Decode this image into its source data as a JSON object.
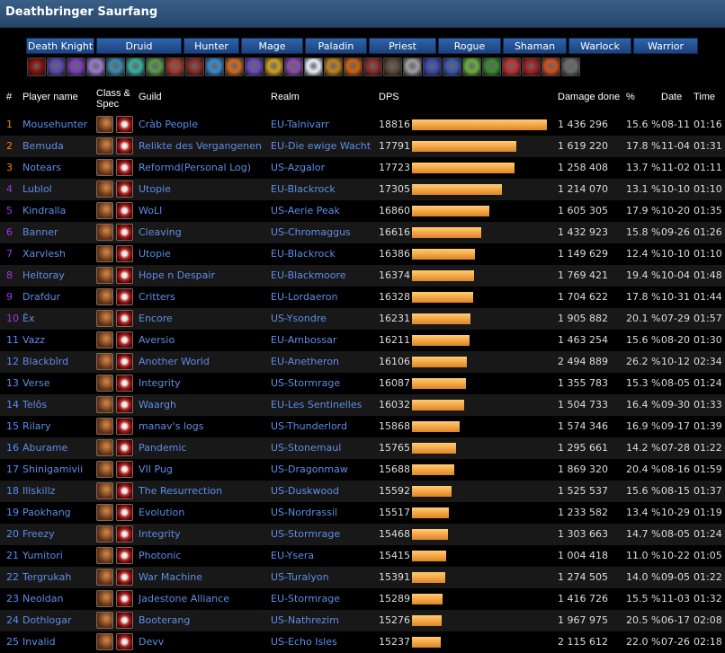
{
  "page_title": "Deathbringer Saurfang",
  "classes": [
    "Death Knight",
    "Druid",
    "Hunter",
    "Mage",
    "Paladin",
    "Priest",
    "Rogue",
    "Shaman",
    "Warlock",
    "Warrior"
  ],
  "spec_icon_colors": [
    "#8a1010",
    "#5a4ab0",
    "#7a3fb8",
    "#9a7ad0",
    "#3a8ab0",
    "#3ab0a0",
    "#5a9a4a",
    "#a43a2a",
    "#8a2a2a",
    "#3a8ad0",
    "#d06a20",
    "#6a4ac0",
    "#d0a020",
    "#8a4ab0",
    "#e8f0f8",
    "#c08020",
    "#d06010",
    "#8a2a2a",
    "#5a4a3a",
    "#a0a0a0",
    "#3a4ab0",
    "#3a5ab0",
    "#6ab040",
    "#3a8a30",
    "#c03030",
    "#a02020",
    "#d05020",
    "#6a6a6a"
  ],
  "headers": {
    "rank": "#",
    "player": "Player name",
    "class_spec_1": "Class &",
    "class_spec_2": "Spec",
    "guild": "Guild",
    "realm": "Realm",
    "dps": "DPS",
    "damage": "Damage done",
    "pct": "%",
    "date": "Date",
    "time": "Time"
  },
  "rows": [
    {
      "rank": "1",
      "player": "Mousehunter",
      "guild": "Cràb People",
      "realm": "EU-Talnivarr",
      "dps": 18816,
      "dps_label": "18816",
      "damage": "1 436 296",
      "pct": "15.6 %",
      "date": "08-11",
      "time": "01:16"
    },
    {
      "rank": "2",
      "player": "Bemuda",
      "guild": "Relikte des Vergangenen",
      "realm": "EU-Die ewige Wacht",
      "dps": 17791,
      "dps_label": "17791",
      "damage": "1 619 220",
      "pct": "17.8 %",
      "date": "11-04",
      "time": "01:31"
    },
    {
      "rank": "3",
      "player": "Notears",
      "guild": "Reformd(Personal Log)",
      "realm": "US-Azgalor",
      "dps": 17723,
      "dps_label": "17723",
      "damage": "1 258 408",
      "pct": "13.7 %",
      "date": "11-02",
      "time": "01:11"
    },
    {
      "rank": "4",
      "player": "Lublol",
      "guild": "Utopie",
      "realm": "EU-Blackrock",
      "dps": 17305,
      "dps_label": "17305",
      "damage": "1 214 070",
      "pct": "13.1 %",
      "date": "10-10",
      "time": "01:10"
    },
    {
      "rank": "5",
      "player": "Kindralla",
      "guild": "WoLl",
      "realm": "US-Aerie Peak",
      "dps": 16860,
      "dps_label": "16860",
      "damage": "1 605 305",
      "pct": "17.9 %",
      "date": "10-20",
      "time": "01:35"
    },
    {
      "rank": "6",
      "player": "Banner",
      "guild": "Cleaving",
      "realm": "US-Chromaggus",
      "dps": 16616,
      "dps_label": "16616",
      "damage": "1 432 923",
      "pct": "15.8 %",
      "date": "09-26",
      "time": "01:26"
    },
    {
      "rank": "7",
      "player": "Xarvlesh",
      "guild": "Utopie",
      "realm": "EU-Blackrock",
      "dps": 16386,
      "dps_label": "16386",
      "damage": "1 149 629",
      "pct": "12.4 %",
      "date": "10-10",
      "time": "01:10"
    },
    {
      "rank": "8",
      "player": "Heltoray",
      "guild": "Hope n Despair",
      "realm": "EU-Blackmoore",
      "dps": 16374,
      "dps_label": "16374",
      "damage": "1 769 421",
      "pct": "19.4 %",
      "date": "10-04",
      "time": "01:48"
    },
    {
      "rank": "9",
      "player": "Drafdur",
      "guild": "Critters",
      "realm": "EU-Lordaeron",
      "dps": 16328,
      "dps_label": "16328",
      "damage": "1 704 622",
      "pct": "17.8 %",
      "date": "10-31",
      "time": "01:44"
    },
    {
      "rank": "10",
      "player": "Èx",
      "guild": "Encore",
      "realm": "US-Ysondre",
      "dps": 16231,
      "dps_label": "16231",
      "damage": "1 905 882",
      "pct": "20.1 %",
      "date": "07-29",
      "time": "01:57"
    },
    {
      "rank": "11",
      "player": "Vazz",
      "guild": "Aversio",
      "realm": "EU-Ambossar",
      "dps": 16211,
      "dps_label": "16211",
      "damage": "1 463 254",
      "pct": "15.6 %",
      "date": "08-20",
      "time": "01:30"
    },
    {
      "rank": "12",
      "player": "Blackbîrd",
      "guild": "Another World",
      "realm": "EU-Anetheron",
      "dps": 16106,
      "dps_label": "16106",
      "damage": "2 494 889",
      "pct": "26.2 %",
      "date": "10-12",
      "time": "02:34"
    },
    {
      "rank": "13",
      "player": "Verse",
      "guild": "Integrity",
      "realm": "US-Stormrage",
      "dps": 16087,
      "dps_label": "16087",
      "damage": "1 355 783",
      "pct": "15.3 %",
      "date": "08-05",
      "time": "01:24"
    },
    {
      "rank": "14",
      "player": "Telôs",
      "guild": "Waargh",
      "realm": "EU-Les Sentinelles",
      "dps": 16032,
      "dps_label": "16032",
      "damage": "1 504 733",
      "pct": "16.4 %",
      "date": "09-30",
      "time": "01:33"
    },
    {
      "rank": "15",
      "player": "Rilary",
      "guild": "manav's logs",
      "realm": "US-Thunderlord",
      "dps": 15868,
      "dps_label": "15868",
      "damage": "1 574 346",
      "pct": "16.9 %",
      "date": "09-17",
      "time": "01:39"
    },
    {
      "rank": "16",
      "player": "Aburame",
      "guild": "Pandemic",
      "realm": "US-Stonemaul",
      "dps": 15765,
      "dps_label": "15765",
      "damage": "1 295 661",
      "pct": "14.2 %",
      "date": "07-28",
      "time": "01:22"
    },
    {
      "rank": "17",
      "player": "Shinigamivii",
      "guild": "VII Pug",
      "realm": "US-Dragonmaw",
      "dps": 15688,
      "dps_label": "15688",
      "damage": "1 869 320",
      "pct": "20.4 %",
      "date": "08-16",
      "time": "01:59"
    },
    {
      "rank": "18",
      "player": "Illskillz",
      "guild": "The Resurrection",
      "realm": "US-Duskwood",
      "dps": 15592,
      "dps_label": "15592",
      "damage": "1 525 537",
      "pct": "15.6 %",
      "date": "08-15",
      "time": "01:37"
    },
    {
      "rank": "19",
      "player": "Paokhang",
      "guild": "Evolution",
      "realm": "US-Nordrassil",
      "dps": 15517,
      "dps_label": "15517",
      "damage": "1 233 582",
      "pct": "13.4 %",
      "date": "10-29",
      "time": "01:19"
    },
    {
      "rank": "20",
      "player": "Freezy",
      "guild": "Integrity",
      "realm": "US-Stormrage",
      "dps": 15468,
      "dps_label": "15468",
      "damage": "1 303 663",
      "pct": "14.7 %",
      "date": "08-05",
      "time": "01:24"
    },
    {
      "rank": "21",
      "player": "Yumitori",
      "guild": "Photonic",
      "realm": "EU-Ysera",
      "dps": 15415,
      "dps_label": "15415",
      "damage": "1 004 418",
      "pct": "11.0 %",
      "date": "10-22",
      "time": "01:05"
    },
    {
      "rank": "22",
      "player": "Tergrukah",
      "guild": "War Machine",
      "realm": "US-Turalyon",
      "dps": 15391,
      "dps_label": "15391",
      "damage": "1 274 505",
      "pct": "14.0 %",
      "date": "09-05",
      "time": "01:22"
    },
    {
      "rank": "23",
      "player": "Neoldan",
      "guild": "Jadestone Alliance",
      "realm": "EU-Stormrage",
      "dps": 15289,
      "dps_label": "15289",
      "damage": "1 416 726",
      "pct": "15.5 %",
      "date": "11-03",
      "time": "01:32"
    },
    {
      "rank": "24",
      "player": "Dothlogar",
      "guild": "Booterang",
      "realm": "US-Nathrezim",
      "dps": 15276,
      "dps_label": "15276",
      "damage": "1 967 975",
      "pct": "20.5 %",
      "date": "06-17",
      "time": "02:08"
    },
    {
      "rank": "25",
      "player": "Invalid",
      "guild": "Devv",
      "realm": "US-Echo Isles",
      "dps": 15237,
      "dps_label": "15237",
      "damage": "2 115 612",
      "pct": "22.0 %",
      "date": "07-26",
      "time": "02:18"
    }
  ],
  "row_icons": {
    "class_icon": "death-knight-class-icon",
    "spec_icon": "unholy-spec-icon"
  },
  "colors": {
    "rank_top3": "#ff8000",
    "rank_epic": "#a335ee",
    "rank_rest": "#4f8fff",
    "link": "#5d8ee8",
    "bar": "#f0a040"
  }
}
